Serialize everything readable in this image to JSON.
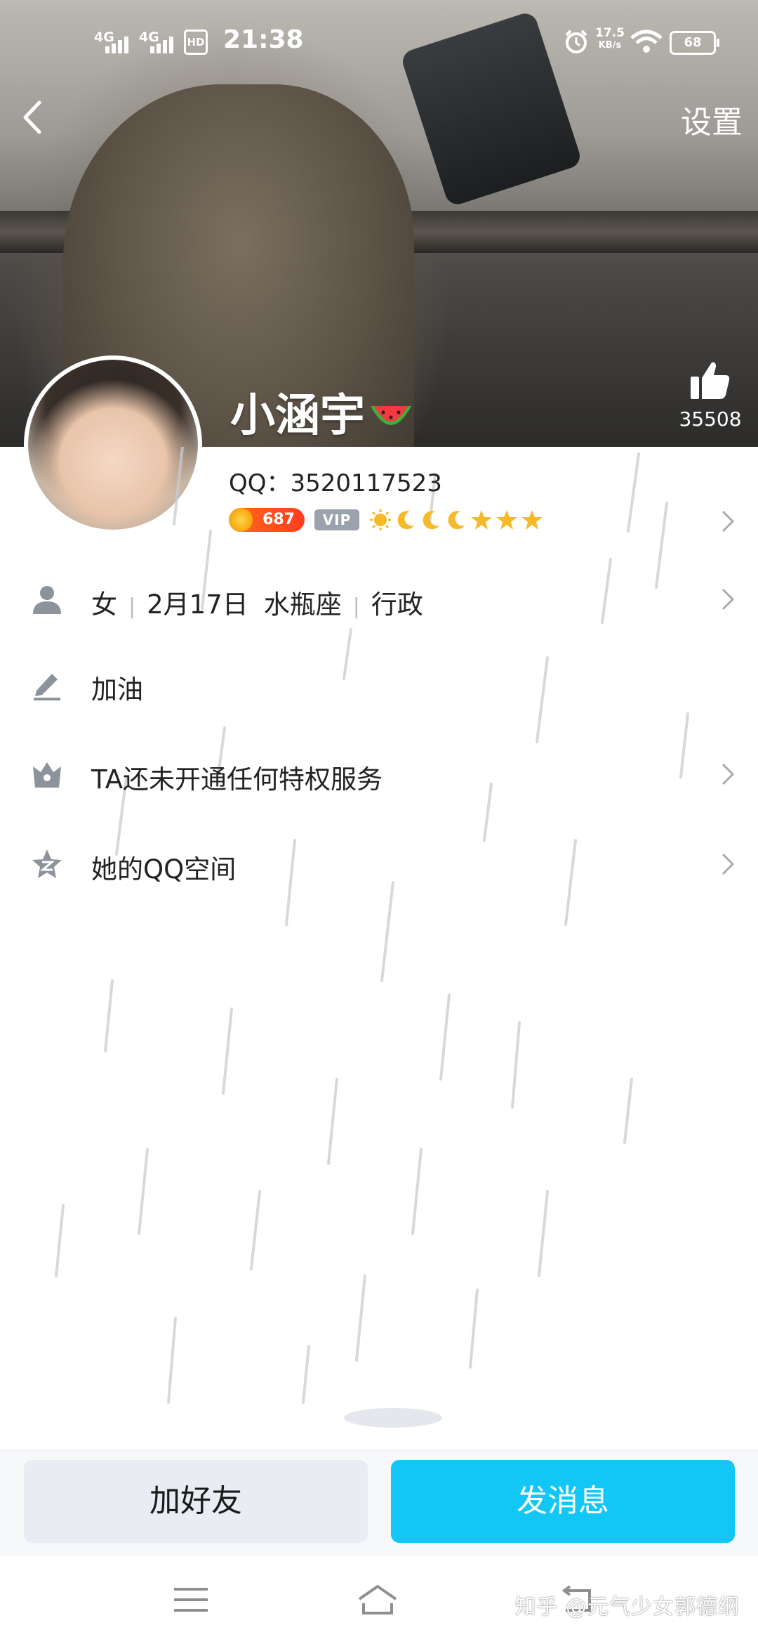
{
  "status_bar": {
    "signal_1": "4G",
    "signal_2": "4G",
    "hd_badge": "HD",
    "time": "21:38",
    "net_speed_value": "17.5",
    "net_speed_unit": "KB/s",
    "battery": "68"
  },
  "header": {
    "settings_label": "设置",
    "likes_count": "35508"
  },
  "profile": {
    "nickname": "小涵宇",
    "qq_label": "QQ：3520117523",
    "coin_level": "687",
    "vip_label": "VIP"
  },
  "info": {
    "gender": "女",
    "birthday": "2月17日",
    "zodiac": "水瓶座",
    "job": "行政",
    "signature": "加油",
    "privilege": "TA还未开通任何特权服务",
    "qzone": "她的QQ空间"
  },
  "actions": {
    "add_friend": "加好友",
    "send_message": "发消息"
  },
  "watermark": "知乎 @元气少女郭德纲",
  "colors": {
    "accent": "#12c7f5",
    "secondary_button": "#e9edf3",
    "coin": "#ff5a1f"
  }
}
